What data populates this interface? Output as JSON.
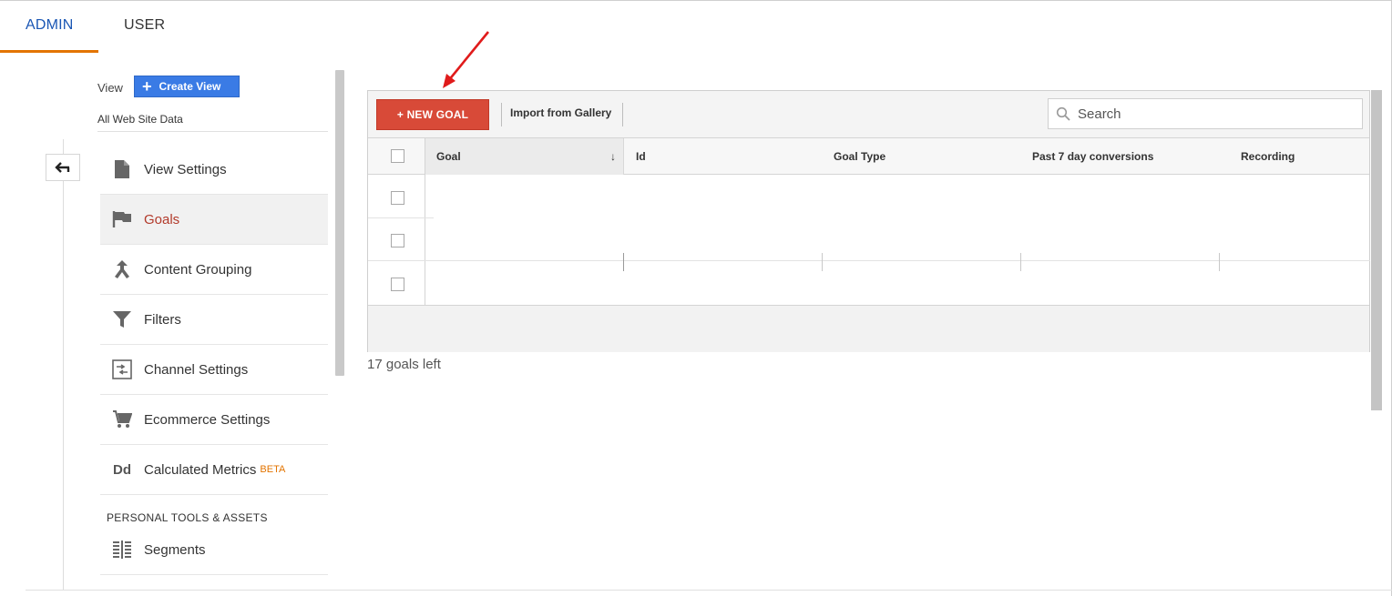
{
  "tabs": {
    "admin": "ADMIN",
    "user": "USER"
  },
  "view_selector": {
    "label": "View",
    "create_button": "Create View",
    "current_view": "All Web Site Data"
  },
  "nav": {
    "items": [
      {
        "label": "View Settings",
        "icon": "document-icon"
      },
      {
        "label": "Goals",
        "icon": "flag-icon",
        "active": true
      },
      {
        "label": "Content Grouping",
        "icon": "content-grouping-icon"
      },
      {
        "label": "Filters",
        "icon": "filter-icon"
      },
      {
        "label": "Channel Settings",
        "icon": "channel-settings-icon"
      },
      {
        "label": "Ecommerce Settings",
        "icon": "cart-icon"
      },
      {
        "label": "Calculated Metrics",
        "icon": "dd-icon",
        "badge": "BETA"
      }
    ],
    "section_heading": "PERSONAL TOOLS & ASSETS",
    "personal_items": [
      {
        "label": "Segments",
        "icon": "segments-icon"
      }
    ],
    "icon_text": {
      "dd": "Dd"
    }
  },
  "toolbar": {
    "new_goal": "+ NEW GOAL",
    "import": "Import from Gallery",
    "search_placeholder": "Search"
  },
  "table": {
    "columns": [
      "Goal",
      "Id",
      "Goal Type",
      "Past 7 day conversions",
      "Recording"
    ],
    "sort_indicator": "↓",
    "rows": [
      [],
      [],
      []
    ]
  },
  "footer_text": "17 goals left",
  "colors": {
    "accent_blue": "#1a56b4",
    "tab_underline": "#e37400",
    "new_goal_red": "#d84a38",
    "create_view_blue": "#3a7be5",
    "active_nav_text": "#b23a2b",
    "annotation_arrow": "#e01b1b"
  }
}
